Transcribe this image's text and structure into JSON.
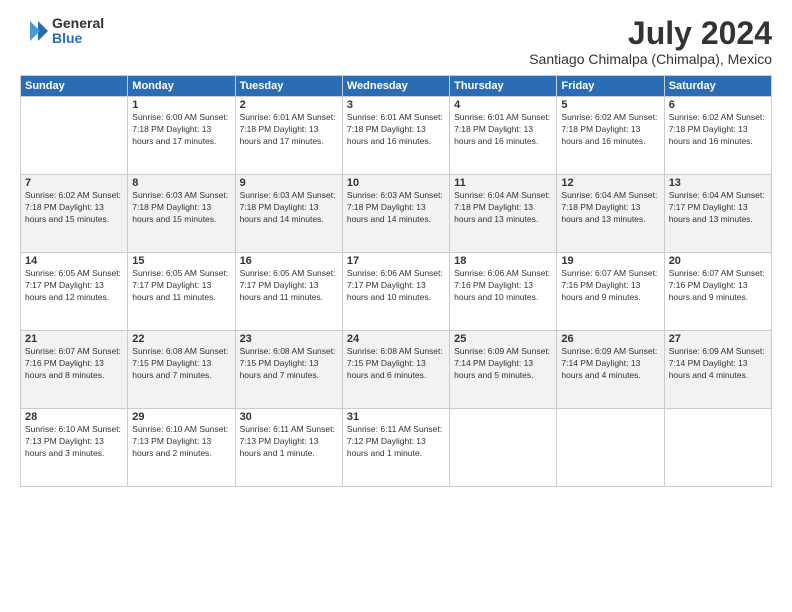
{
  "logo": {
    "general": "General",
    "blue": "Blue"
  },
  "title": "July 2024",
  "subtitle": "Santiago Chimalpa (Chimalpa), Mexico",
  "days": [
    "Sunday",
    "Monday",
    "Tuesday",
    "Wednesday",
    "Thursday",
    "Friday",
    "Saturday"
  ],
  "weeks": [
    [
      {
        "day": "",
        "info": ""
      },
      {
        "day": "1",
        "info": "Sunrise: 6:00 AM\nSunset: 7:18 PM\nDaylight: 13 hours\nand 17 minutes."
      },
      {
        "day": "2",
        "info": "Sunrise: 6:01 AM\nSunset: 7:18 PM\nDaylight: 13 hours\nand 17 minutes."
      },
      {
        "day": "3",
        "info": "Sunrise: 6:01 AM\nSunset: 7:18 PM\nDaylight: 13 hours\nand 16 minutes."
      },
      {
        "day": "4",
        "info": "Sunrise: 6:01 AM\nSunset: 7:18 PM\nDaylight: 13 hours\nand 16 minutes."
      },
      {
        "day": "5",
        "info": "Sunrise: 6:02 AM\nSunset: 7:18 PM\nDaylight: 13 hours\nand 16 minutes."
      },
      {
        "day": "6",
        "info": "Sunrise: 6:02 AM\nSunset: 7:18 PM\nDaylight: 13 hours\nand 16 minutes."
      }
    ],
    [
      {
        "day": "7",
        "info": "Sunrise: 6:02 AM\nSunset: 7:18 PM\nDaylight: 13 hours\nand 15 minutes."
      },
      {
        "day": "8",
        "info": "Sunrise: 6:03 AM\nSunset: 7:18 PM\nDaylight: 13 hours\nand 15 minutes."
      },
      {
        "day": "9",
        "info": "Sunrise: 6:03 AM\nSunset: 7:18 PM\nDaylight: 13 hours\nand 14 minutes."
      },
      {
        "day": "10",
        "info": "Sunrise: 6:03 AM\nSunset: 7:18 PM\nDaylight: 13 hours\nand 14 minutes."
      },
      {
        "day": "11",
        "info": "Sunrise: 6:04 AM\nSunset: 7:18 PM\nDaylight: 13 hours\nand 13 minutes."
      },
      {
        "day": "12",
        "info": "Sunrise: 6:04 AM\nSunset: 7:18 PM\nDaylight: 13 hours\nand 13 minutes."
      },
      {
        "day": "13",
        "info": "Sunrise: 6:04 AM\nSunset: 7:17 PM\nDaylight: 13 hours\nand 13 minutes."
      }
    ],
    [
      {
        "day": "14",
        "info": "Sunrise: 6:05 AM\nSunset: 7:17 PM\nDaylight: 13 hours\nand 12 minutes."
      },
      {
        "day": "15",
        "info": "Sunrise: 6:05 AM\nSunset: 7:17 PM\nDaylight: 13 hours\nand 11 minutes."
      },
      {
        "day": "16",
        "info": "Sunrise: 6:05 AM\nSunset: 7:17 PM\nDaylight: 13 hours\nand 11 minutes."
      },
      {
        "day": "17",
        "info": "Sunrise: 6:06 AM\nSunset: 7:17 PM\nDaylight: 13 hours\nand 10 minutes."
      },
      {
        "day": "18",
        "info": "Sunrise: 6:06 AM\nSunset: 7:16 PM\nDaylight: 13 hours\nand 10 minutes."
      },
      {
        "day": "19",
        "info": "Sunrise: 6:07 AM\nSunset: 7:16 PM\nDaylight: 13 hours\nand 9 minutes."
      },
      {
        "day": "20",
        "info": "Sunrise: 6:07 AM\nSunset: 7:16 PM\nDaylight: 13 hours\nand 9 minutes."
      }
    ],
    [
      {
        "day": "21",
        "info": "Sunrise: 6:07 AM\nSunset: 7:16 PM\nDaylight: 13 hours\nand 8 minutes."
      },
      {
        "day": "22",
        "info": "Sunrise: 6:08 AM\nSunset: 7:15 PM\nDaylight: 13 hours\nand 7 minutes."
      },
      {
        "day": "23",
        "info": "Sunrise: 6:08 AM\nSunset: 7:15 PM\nDaylight: 13 hours\nand 7 minutes."
      },
      {
        "day": "24",
        "info": "Sunrise: 6:08 AM\nSunset: 7:15 PM\nDaylight: 13 hours\nand 6 minutes."
      },
      {
        "day": "25",
        "info": "Sunrise: 6:09 AM\nSunset: 7:14 PM\nDaylight: 13 hours\nand 5 minutes."
      },
      {
        "day": "26",
        "info": "Sunrise: 6:09 AM\nSunset: 7:14 PM\nDaylight: 13 hours\nand 4 minutes."
      },
      {
        "day": "27",
        "info": "Sunrise: 6:09 AM\nSunset: 7:14 PM\nDaylight: 13 hours\nand 4 minutes."
      }
    ],
    [
      {
        "day": "28",
        "info": "Sunrise: 6:10 AM\nSunset: 7:13 PM\nDaylight: 13 hours\nand 3 minutes."
      },
      {
        "day": "29",
        "info": "Sunrise: 6:10 AM\nSunset: 7:13 PM\nDaylight: 13 hours\nand 2 minutes."
      },
      {
        "day": "30",
        "info": "Sunrise: 6:11 AM\nSunset: 7:13 PM\nDaylight: 13 hours\nand 1 minute."
      },
      {
        "day": "31",
        "info": "Sunrise: 6:11 AM\nSunset: 7:12 PM\nDaylight: 13 hours\nand 1 minute."
      },
      {
        "day": "",
        "info": ""
      },
      {
        "day": "",
        "info": ""
      },
      {
        "day": "",
        "info": ""
      }
    ]
  ]
}
